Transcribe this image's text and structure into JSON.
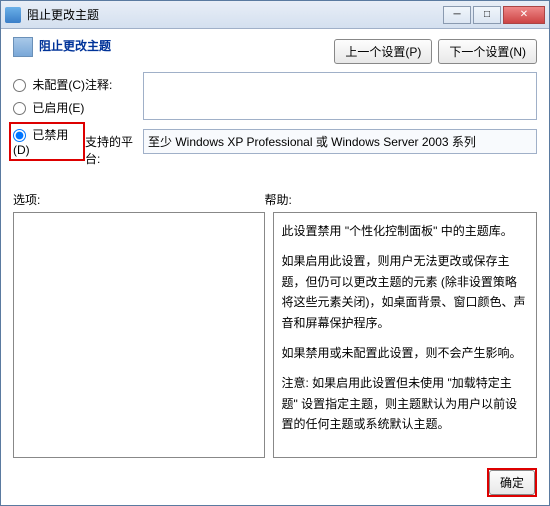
{
  "titlebar": {
    "text": "阻止更改主题"
  },
  "header": {
    "title": "阻止更改主题"
  },
  "nav": {
    "prev": "上一个设置(P)",
    "next": "下一个设置(N)"
  },
  "radios": {
    "notconfig": "未配置(C)",
    "enabled": "已启用(E)",
    "disabled": "已禁用(D)"
  },
  "fields": {
    "comment_label": "注释:",
    "comment_value": "",
    "platform_label": "支持的平台:",
    "platform_value": "至少 Windows XP Professional 或 Windows Server 2003 系列"
  },
  "panels": {
    "options_label": "选项:",
    "help_label": "帮助:",
    "help": {
      "p1": "此设置禁用 \"个性化控制面板\" 中的主题库。",
      "p2": "如果启用此设置，则用户无法更改或保存主题，但仍可以更改主题的元素 (除非设置策略将这些元素关闭)，如桌面背景、窗口颜色、声音和屏幕保护程序。",
      "p3": "如果禁用或未配置此设置，则不会产生影响。",
      "p4": "注意: 如果启用此设置但未使用 \"加载特定主题\" 设置指定主题，则主题默认为用户以前设置的任何主题或系统默认主题。"
    }
  },
  "footer": {
    "ok": "确定"
  }
}
